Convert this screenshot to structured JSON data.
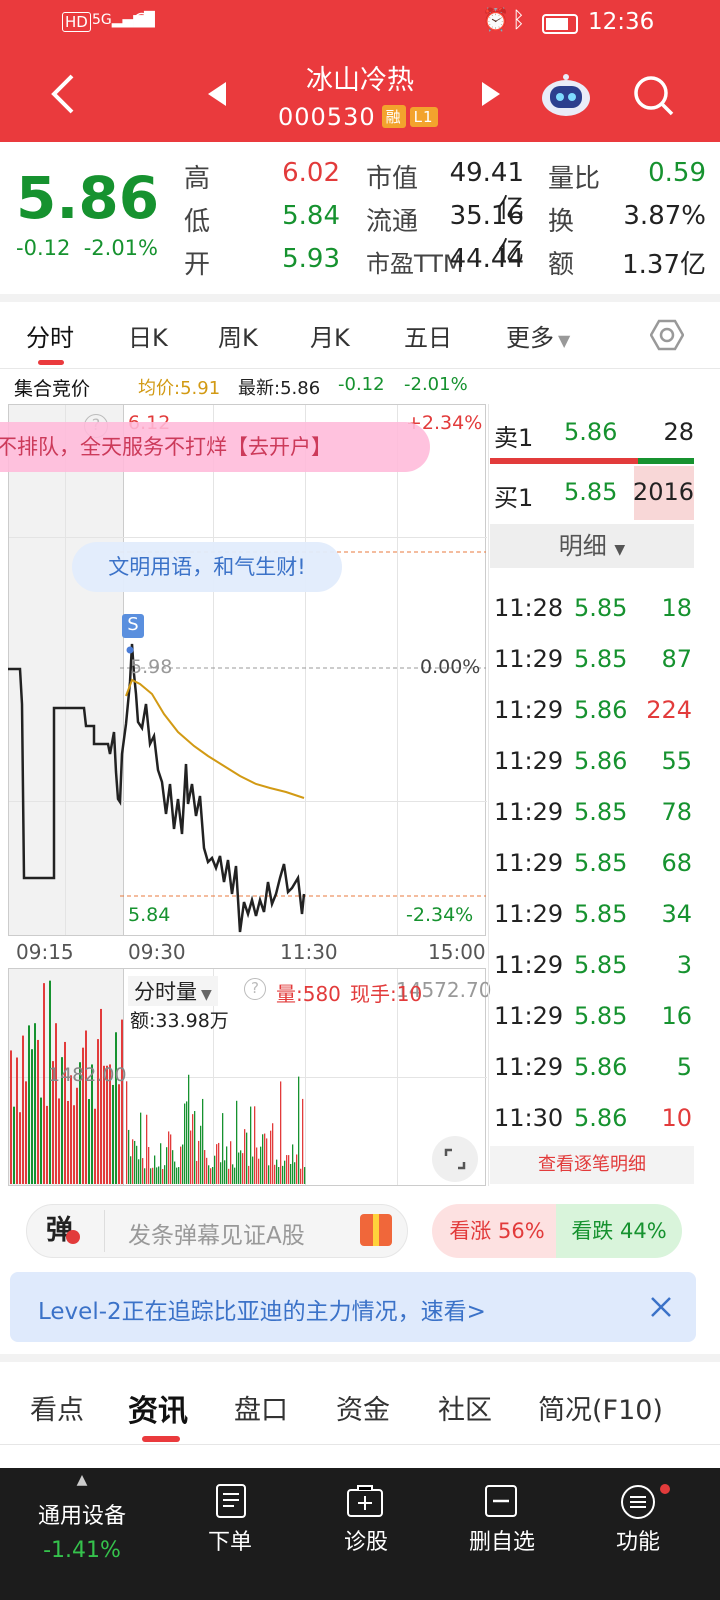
{
  "status": {
    "left_icons": "HD 5G",
    "time": "12:36"
  },
  "header": {
    "title": "冰山冷热",
    "code": "000530",
    "tag1": "融",
    "tag2": "L1"
  },
  "quote": {
    "price": "5.86",
    "change": "-0.12",
    "change_pct": "-2.01%",
    "stats": [
      {
        "label": "高",
        "value": "6.02",
        "color": "red"
      },
      {
        "label": "低",
        "value": "5.84",
        "color": "green"
      },
      {
        "label": "开",
        "value": "5.93",
        "color": "green"
      }
    ],
    "stats2": [
      {
        "label": "市值",
        "value": "49.41亿"
      },
      {
        "label": "流通",
        "value": "35.16亿"
      },
      {
        "label": "市盈TTM",
        "value": "44.44"
      }
    ],
    "stats3": [
      {
        "label": "量比",
        "value": "0.59",
        "color": "green"
      },
      {
        "label": "换",
        "value": "3.87%",
        "color": "black"
      },
      {
        "label": "额",
        "value": "1.37亿",
        "color": "black"
      }
    ]
  },
  "tabs": [
    "分时",
    "日K",
    "周K",
    "月K",
    "五日",
    "更多"
  ],
  "info_bar": {
    "auction": "集合竞价",
    "avg": "均价:5.91",
    "latest": "最新:5.86",
    "chg": "-0.12",
    "pct": "-2.01%"
  },
  "chart": {
    "top_price": "6.12",
    "top_pct": "+2.34%",
    "mid_price": "5.98",
    "mid_pct": "0.00%",
    "bot_price": "5.84",
    "bot_pct": "-2.34%",
    "times": [
      "09:15",
      "09:30",
      "11:30",
      "15:00"
    ],
    "ad_banner": "开户不排队，全天服务不打烊【去开户】",
    "chat_banner": "文明用语，和气生财!",
    "marker": "S"
  },
  "volume": {
    "selector": "分时量",
    "vol": "量:580",
    "hand": "现手:10",
    "max": "14572.70",
    "amount": "额:33.98万",
    "mid": "1482.00"
  },
  "orderbook": {
    "sell": {
      "label": "卖1",
      "price": "5.86",
      "qty": "28"
    },
    "buy": {
      "label": "买1",
      "price": "5.85",
      "qty": "2016"
    },
    "detail_label": "明细",
    "trades": [
      {
        "t": "11:28",
        "p": "5.85",
        "q": "18",
        "c": "green"
      },
      {
        "t": "11:29",
        "p": "5.85",
        "q": "87",
        "c": "green"
      },
      {
        "t": "11:29",
        "p": "5.86",
        "q": "224",
        "c": "red"
      },
      {
        "t": "11:29",
        "p": "5.86",
        "q": "55",
        "c": "green"
      },
      {
        "t": "11:29",
        "p": "5.85",
        "q": "78",
        "c": "green"
      },
      {
        "t": "11:29",
        "p": "5.85",
        "q": "68",
        "c": "green"
      },
      {
        "t": "11:29",
        "p": "5.85",
        "q": "34",
        "c": "green"
      },
      {
        "t": "11:29",
        "p": "5.85",
        "q": "3",
        "c": "green"
      },
      {
        "t": "11:29",
        "p": "5.85",
        "q": "16",
        "c": "green"
      },
      {
        "t": "11:29",
        "p": "5.86",
        "q": "5",
        "c": "green"
      },
      {
        "t": "11:30",
        "p": "5.86",
        "q": "10",
        "c": "red"
      }
    ],
    "view_all": "查看逐笔明细"
  },
  "danmu": {
    "icon": "弹",
    "placeholder": "发条弹幕见证A股",
    "up": "看涨 56%",
    "down": "看跌 44%"
  },
  "level2": {
    "text": "Level-2正在追踪比亚迪的主力情况，速看>"
  },
  "bottom_tabs": [
    "看点",
    "资讯",
    "盘口",
    "资金",
    "社区",
    "简况(F10)"
  ],
  "nav": {
    "sector": "通用设备",
    "sector_pct": "-1.41%",
    "items": [
      "下单",
      "诊股",
      "删自选",
      "功能"
    ]
  },
  "colors": {
    "header": "#ea3a3d",
    "up": "#e23b3b",
    "down": "#16922f",
    "avg": "#d29a14"
  }
}
